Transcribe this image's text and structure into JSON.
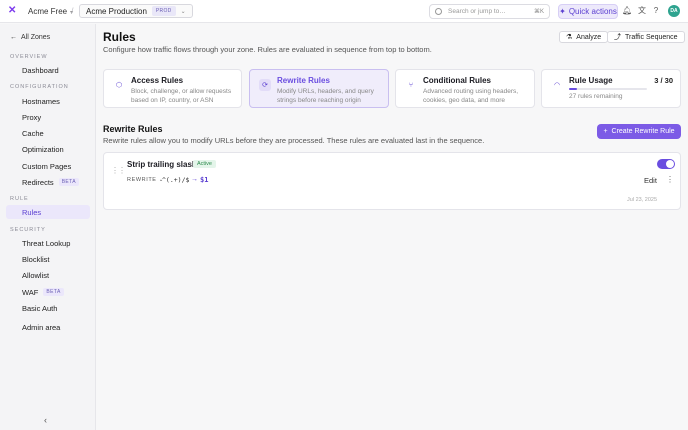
{
  "topbar": {
    "org_name": "Acme Free",
    "zone_name": "Acme Production",
    "zone_badge": "PROD",
    "search_placeholder": "Search or jump to…",
    "search_shortcut": "⌘K",
    "quick_actions_label": "Quick actions",
    "avatar_initials": "DA"
  },
  "sidebar": {
    "back_label": "All Zones",
    "sections": [
      {
        "label": "OVERVIEW",
        "items": [
          {
            "label": "Dashboard"
          }
        ]
      },
      {
        "label": "CONFIGURATION",
        "items": [
          {
            "label": "Hostnames"
          },
          {
            "label": "Proxy"
          },
          {
            "label": "Cache"
          },
          {
            "label": "Optimization"
          },
          {
            "label": "Custom Pages"
          },
          {
            "label": "Redirects",
            "badge": "BETA"
          }
        ]
      },
      {
        "label": "RULE",
        "items": [
          {
            "label": "Rules",
            "active": true
          }
        ]
      },
      {
        "label": "SECURITY",
        "items": [
          {
            "label": "Threat Lookup"
          },
          {
            "label": "Blocklist"
          },
          {
            "label": "Allowlist"
          },
          {
            "label": "WAF",
            "badge": "BETA"
          },
          {
            "label": "Basic Auth"
          }
        ]
      },
      {
        "label": "",
        "items": [
          {
            "label": "Admin area"
          }
        ]
      }
    ]
  },
  "header": {
    "title": "Rules",
    "subtitle": "Configure how traffic flows through your zone. Rules are evaluated in sequence from top to bottom.",
    "analyze_label": "Analyze",
    "traffic_label": "Traffic Sequence"
  },
  "cards": [
    {
      "title": "Access Rules",
      "desc": "Block, challenge, or allow requests based on IP, country, or ASN"
    },
    {
      "title": "Rewrite Rules",
      "desc": "Modify URLs, headers, and query strings before reaching origin"
    },
    {
      "title": "Conditional Rules",
      "desc": "Advanced routing using headers, cookies, geo data, and more"
    }
  ],
  "usage": {
    "title": "Rule Usage",
    "count": "3 / 30",
    "remaining": "27 rules remaining",
    "fraction": 0.1
  },
  "rewrite_section": {
    "title": "Rewrite Rules",
    "subtitle": "Rewrite rules allow you to modify URLs before they are processed. These rules are evaluated last in the sequence.",
    "create_label": "Create Rewrite Rule"
  },
  "rule": {
    "name": "Strip trailing slash",
    "status": "Active",
    "type": "REWRITE",
    "pattern": "^(.+)/$",
    "arrow": "→",
    "replacement": "$1",
    "edit_label": "Edit",
    "date": "Jul 23, 2025"
  },
  "colors": {
    "accent": "#7c5be6",
    "active_green": "#2c8a4c"
  }
}
